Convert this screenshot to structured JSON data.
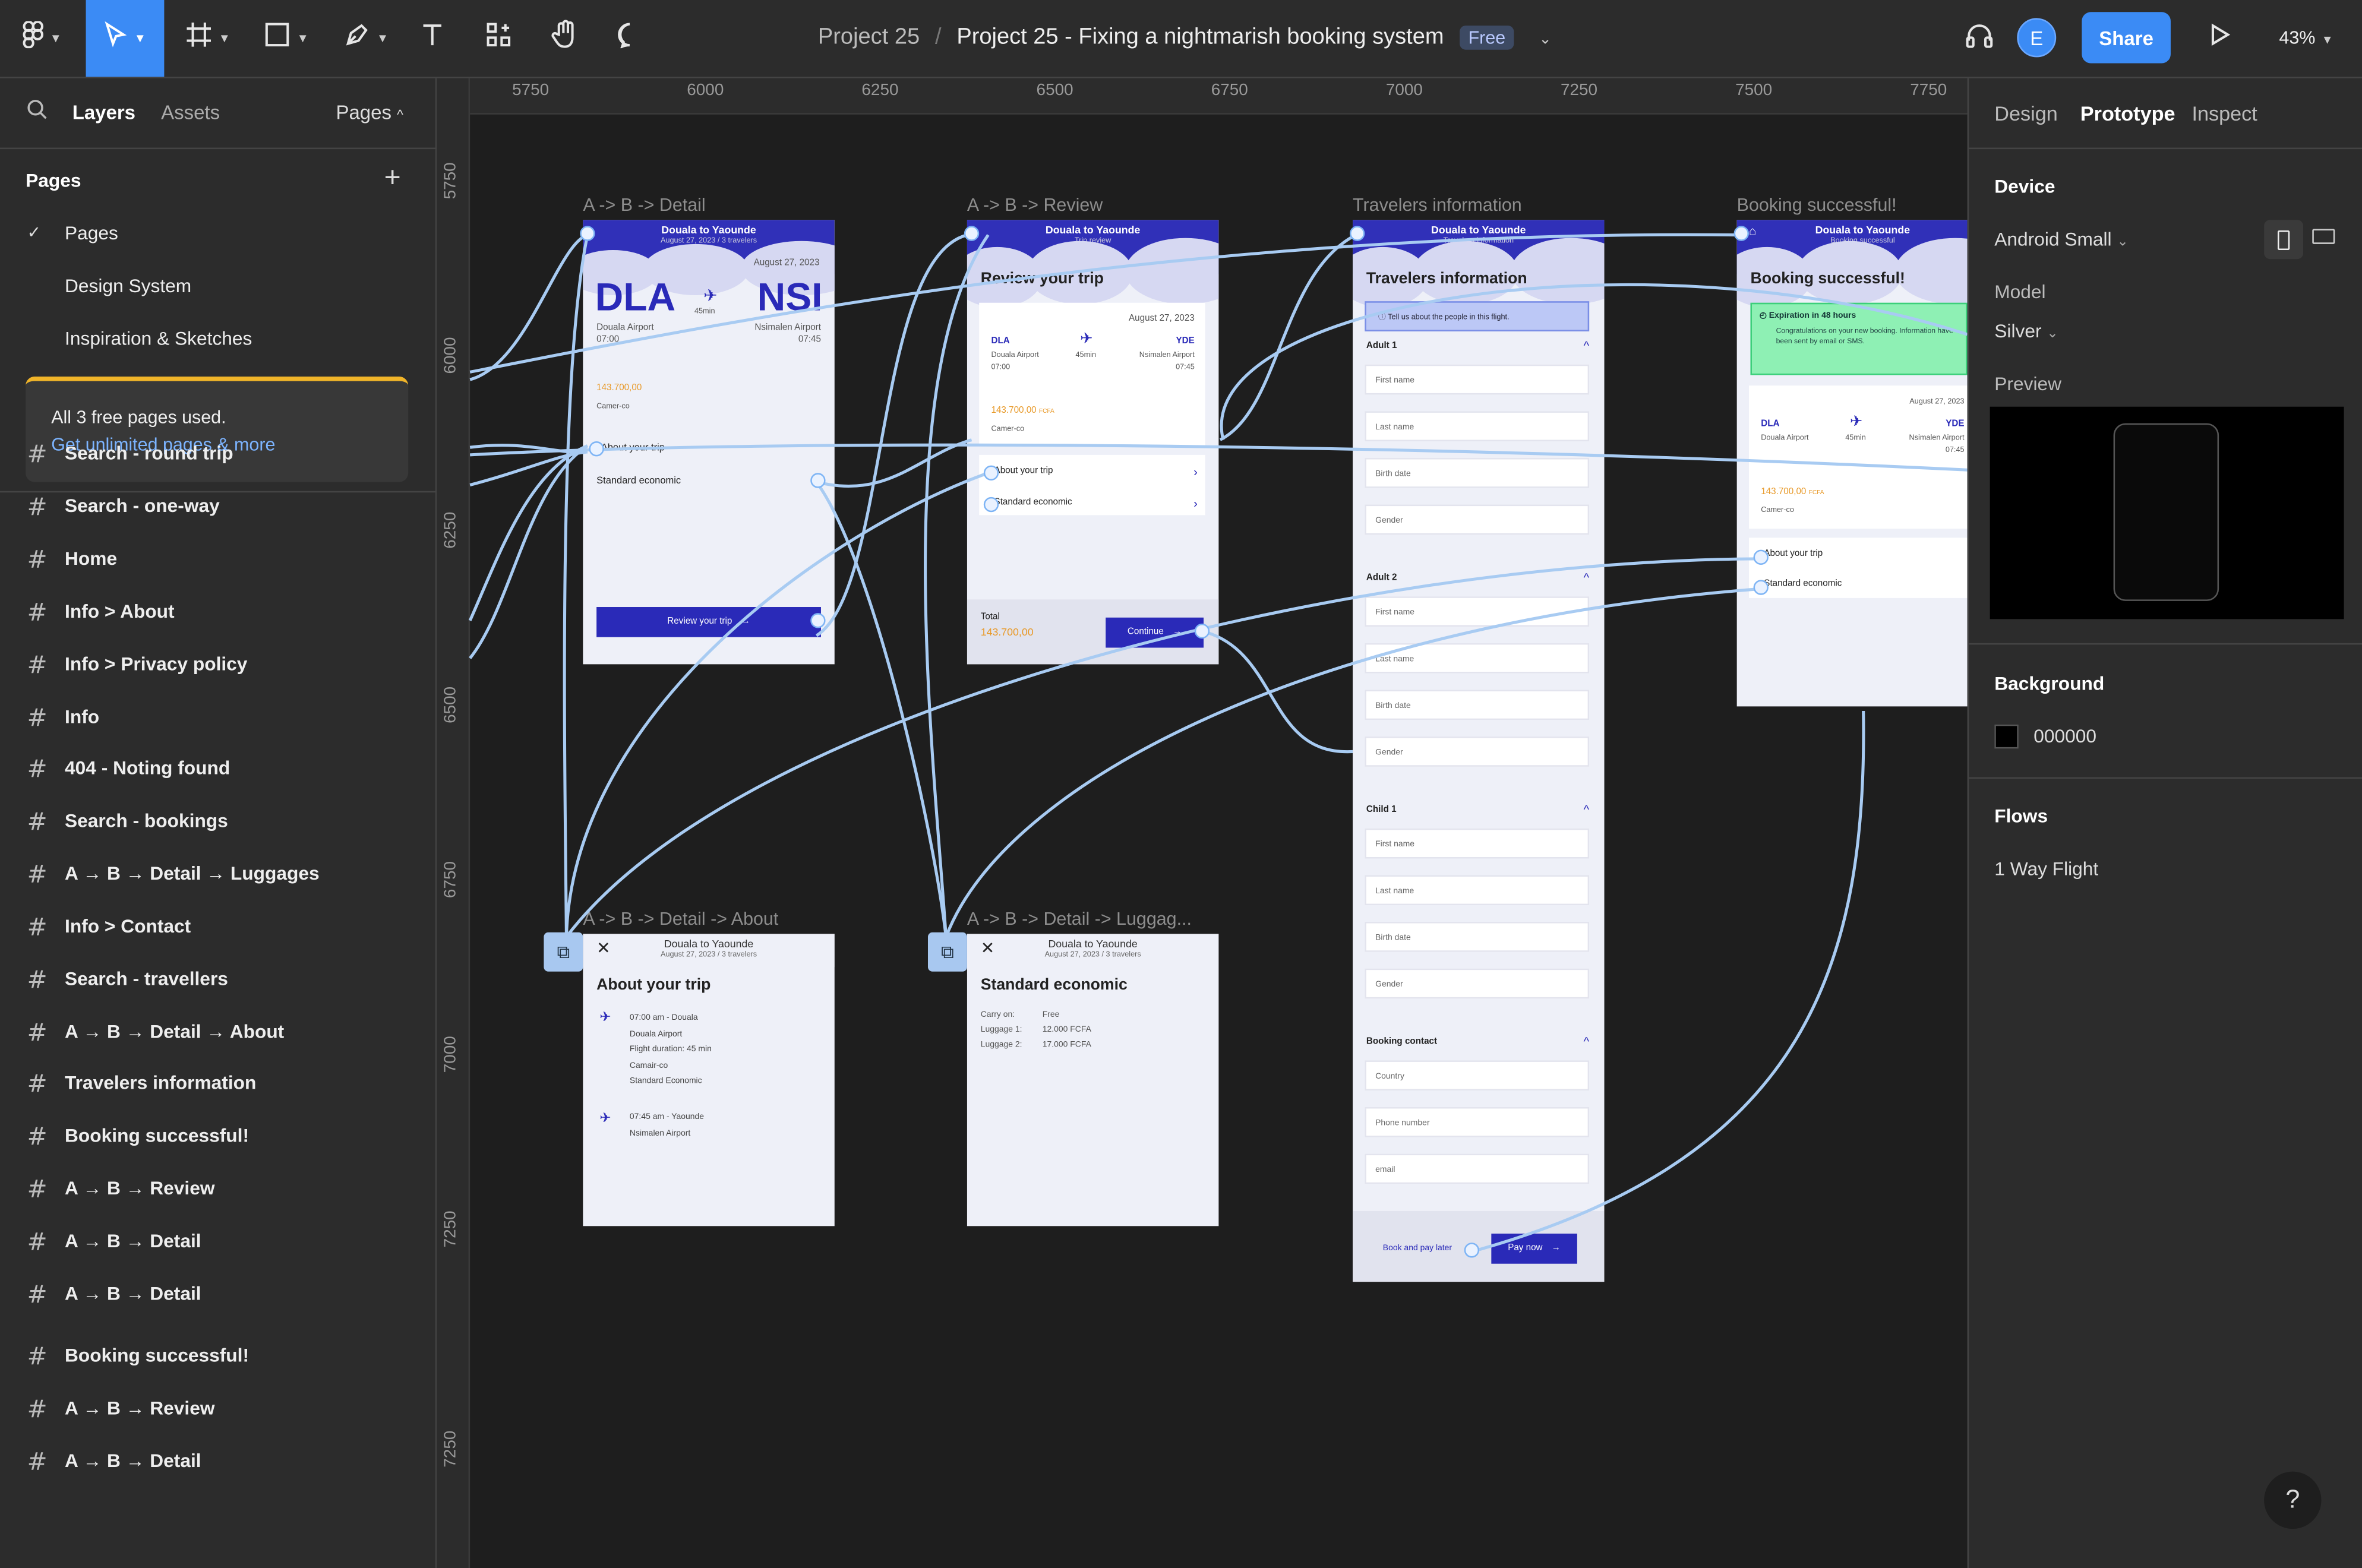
{
  "app": {
    "project": "Project 25",
    "file_title": "Project 25 - Fixing a nightmarish booking system",
    "plan_badge": "Free",
    "share_label": "Share",
    "avatar_initial": "E",
    "zoom": "43%"
  },
  "left_panel": {
    "tabs": [
      "Layers",
      "Assets"
    ],
    "pages_dropdown": "Pages",
    "pages_heading": "Pages",
    "pages": [
      "Pages",
      "Design System",
      "Inspiration & Sketches"
    ],
    "upsell_title": "All 3 free pages used.",
    "upsell_link": "Get unlimited pages & more",
    "frames": [
      "Search - round trip",
      "Search - one-way",
      "Home",
      "Info > About",
      "Info > Privacy policy",
      "Info",
      "404 - Noting found",
      "Search - bookings",
      "A → B → Detail → Luggages",
      "Info > Contact",
      "Search - travellers",
      "A → B → Detail → About",
      "Travelers information",
      "Booking successful!",
      "A → B → Review",
      "A → B → Detail",
      "A → B → Detail",
      "Booking successful!",
      "A → B → Review",
      "A → B → Detail"
    ]
  },
  "right_panel": {
    "tabs": [
      "Design",
      "Prototype",
      "Inspect"
    ],
    "device_heading": "Device",
    "device_value": "Android Small",
    "model_label": "Model",
    "model_value": "Silver",
    "preview_label": "Preview",
    "background_heading": "Background",
    "background_value": "000000",
    "flows_heading": "Flows",
    "flow_item": "1 Way Flight",
    "help": "?"
  },
  "canvas": {
    "ruler_x": [
      "5750",
      "6000",
      "6250",
      "6500",
      "6750",
      "7000",
      "7250",
      "7500",
      "7750"
    ],
    "ruler_y": [
      "5750",
      "6000",
      "6250",
      "6500",
      "6750",
      "7000",
      "7250",
      "7250"
    ],
    "frame_labels": {
      "detail": "A -> B -> Detail",
      "review": "A -> B -> Review",
      "travelers": "Travelers information",
      "success": "Booking successful!",
      "about": "A -> B -> Detail -> About",
      "luggage": "A -> B -> Detail -> Luggag..."
    },
    "detail": {
      "header_title": "Douala to Yaounde",
      "header_sub": "August 27, 2023 / 3 travelers",
      "date": "August 27, 2023",
      "from": "DLA",
      "to": "NSI",
      "duration": "45min",
      "from_airport": "Douala Airport",
      "to_airport": "Nsimalen Airport",
      "dep_time": "07:00",
      "arr_time": "07:45",
      "price": "143.700,00",
      "airline": "Camer-co",
      "about": "About your trip",
      "fare": "Standard economic",
      "cta": "Review your trip"
    },
    "review": {
      "header_title": "Douala to Yaounde",
      "header_sub": "Trip review",
      "title": "Review your trip",
      "date": "August 27, 2023",
      "from": "DLA",
      "to": "YDE",
      "from_airport": "Douala Airport",
      "to_airport": "Nsimalen Airport",
      "dep_time": "07:00",
      "arr_time": "07:45",
      "duration": "45min",
      "price": "143.700,00",
      "currency": "FCFA",
      "airline": "Camer-co",
      "about": "About your trip",
      "fare": "Standard economic",
      "total_label": "Total",
      "total_value": "143.700,00",
      "cta": "Continue"
    },
    "travelers": {
      "header_title": "Douala to Yaounde",
      "header_sub": "Travelers information",
      "title": "Travelers information",
      "info": "Tell us about the people in this flight.",
      "sections": [
        {
          "name": "Adult 1",
          "fields": [
            "First name",
            "Last name",
            "Birth date",
            "Gender"
          ]
        },
        {
          "name": "Adult 2",
          "fields": [
            "First name",
            "Last name",
            "Birth date",
            "Gender"
          ]
        },
        {
          "name": "Child 1",
          "fields": [
            "First name",
            "Last name",
            "Birth date",
            "Gender"
          ]
        },
        {
          "name": "Booking contact",
          "fields": [
            "Country",
            "Phone number",
            "email"
          ]
        }
      ],
      "later": "Book and pay later",
      "cta": "Pay now"
    },
    "success": {
      "header_title": "Douala to Yaounde",
      "header_sub": "Booking successful",
      "title": "Booking successful!",
      "banner_title": "Expiration in 48 hours",
      "banner_text": "Congratulations on your new booking. Information have been sent by email or SMS.",
      "date": "August 27, 2023",
      "from": "DLA",
      "to": "YDE",
      "duration": "45min",
      "from_airport": "Douala Airport",
      "to_airport": "Nsimalen Airport",
      "arr_time": "07:45",
      "price": "143.700,00",
      "currency": "FCFA",
      "airline": "Camer-co",
      "about": "About your trip",
      "fare": "Standard economic"
    },
    "about": {
      "header_title": "Douala to Yaounde",
      "header_sub": "August 27, 2023 / 3 travelers",
      "title": "About your trip",
      "dep_lines": [
        "07:00 am - Douala",
        "Douala Airport",
        "Flight duration: 45 min",
        "Camair-co",
        "Standard Economic"
      ],
      "arr_lines": [
        "07:45 am - Yaounde",
        "Nsimalen Airport"
      ]
    },
    "luggage": {
      "header_title": "Douala to Yaounde",
      "header_sub": "August 27, 2023 / 3 travelers",
      "title": "Standard economic",
      "rows": [
        {
          "label": "Carry on:",
          "value": "Free"
        },
        {
          "label": "Luggage 1:",
          "value": "12.000 FCFA"
        },
        {
          "label": "Luggage 2:",
          "value": "17.000 FCFA"
        }
      ]
    }
  }
}
